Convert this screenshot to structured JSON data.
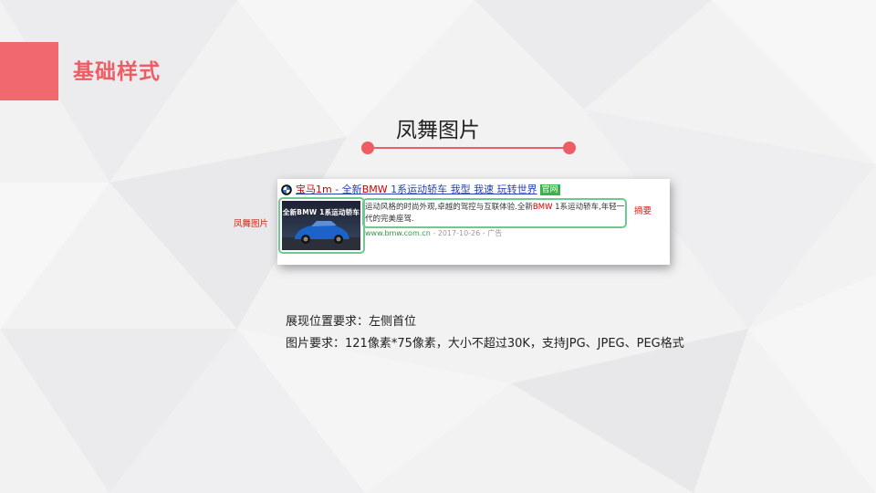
{
  "section_title": "基础样式",
  "heading": "凤舞图片",
  "ad": {
    "title_part1": "宝马1m",
    "title_part2": " - 全新",
    "title_part3": "BMW",
    "title_part4": " 1系运动轿车 我型 我速 玩转世界",
    "official_badge": "官网",
    "image_caption": "全新BMW 1系运动轿车",
    "desc_part1": "运动风格的时尚外观,卓越的驾控与互联体验.全新",
    "desc_part2": "BMW",
    "desc_part3": " 1系运动轿车,年轻一代的完美座驾.",
    "url": "www.bmw.com.cn",
    "url_meta": " - 2017-10-26  - 广告"
  },
  "labels": {
    "image_label": "凤舞图片",
    "summary_label": "摘要"
  },
  "requirements": [
    "展现位置要求：左侧首位",
    "图片要求：121像素*75像素，大小不超过30K，支持JPG、JPEG、PEG格式"
  ],
  "colors": {
    "accent": "#ee5d63",
    "highlight_box": "#6cc990",
    "label_red": "#d0271d",
    "link_blue": "#2440b3",
    "url_green": "#2e9a49"
  }
}
